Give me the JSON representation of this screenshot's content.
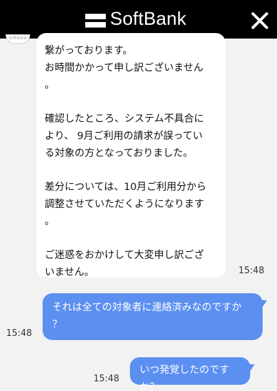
{
  "header": {
    "brand": "SoftBank",
    "logo_icon": "softbank-logo-icon",
    "close_icon": "close-icon"
  },
  "avatar": {
    "label": "SoftBank"
  },
  "agent_message": {
    "lines": [
      "繋がっております。",
      "お時間かかって申し訳ございません",
      "。",
      "確認したところ、システム不具合に",
      "より、 9月ご利用の請求が誤ってい",
      "る対象の方となっておりました。",
      "差分については、10月ご利用分から",
      "調整させていただくようになります",
      "。",
      "ご迷惑をおかけして大変申し訳ござ",
      "いません。"
    ],
    "time": "15:48"
  },
  "user_messages": [
    {
      "lines": [
        "それは全ての対象者に連絡済みなのですか",
        "？"
      ],
      "time": "15:48"
    },
    {
      "lines": [
        "いつ発覚したのですか？"
      ],
      "time": "15:48"
    }
  ]
}
